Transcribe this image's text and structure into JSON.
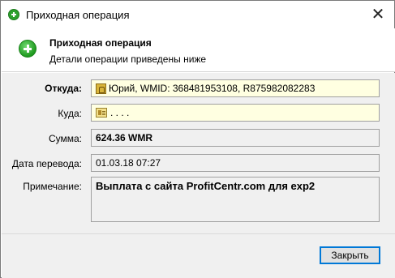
{
  "window": {
    "title": "Приходная операция",
    "close_glyph": "✕"
  },
  "header": {
    "title": "Приходная операция",
    "subtitle": "Детали операции приведены ниже"
  },
  "form": {
    "from_label": "Откуда:",
    "from_value": "Юрий, WMID: 368481953108, R875982082283",
    "to_label": "Куда:",
    "to_value": ".           .           .                                                                   .",
    "amount_label": "Сумма:",
    "amount_value": "624.36 WMR",
    "date_label": "Дата перевода:",
    "date_value": "01.03.18 07:27",
    "note_label": "Примечание:",
    "note_value": "Выплата с сайта ProfitCentr.com для exp2"
  },
  "footer": {
    "close_button_label": "Закрыть"
  },
  "icons": {
    "title_icon": "add-circle-icon",
    "header_icon": "add-circle-icon",
    "from_icon": "purse-icon",
    "to_icon": "wallet-card-icon"
  },
  "colors": {
    "accent": "#0078d7",
    "field_highlight": "#ffffe1",
    "icon_green": "#2ea12e"
  }
}
